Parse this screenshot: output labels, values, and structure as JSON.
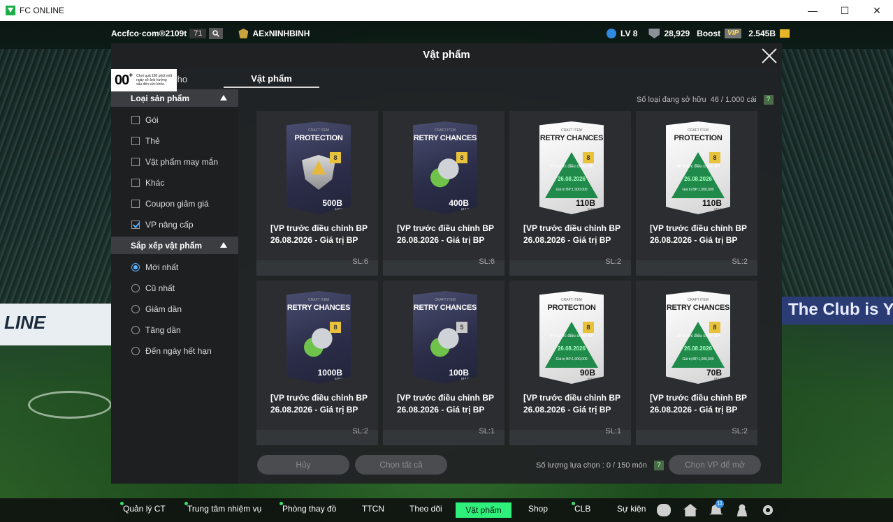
{
  "window": {
    "title": "FC ONLINE",
    "minimize": "—",
    "maximize": "☐",
    "close": "✕"
  },
  "topbar": {
    "account": "Accfco·com®2109t",
    "account_num": "71",
    "club_name": "AExNINHBINH",
    "level": "LV 8",
    "rank_points": "28,929",
    "boost": "Boost",
    "vip": "VIP",
    "bp": "2.545B"
  },
  "modal": {
    "title": "Vật phẩm",
    "rating": {
      "age": "00",
      "plus": "+",
      "notice": "Chơi quá 180 phút một ngày sẽ ảnh hưởng xấu đến sức khỏe."
    },
    "tabs": {
      "kho": "Kho",
      "vat_pham": "Vật phẩm"
    },
    "owned_label": "Số loại đang sở hữu",
    "owned_value": "46 / 1.000 cái",
    "help": "?"
  },
  "sidebar": {
    "type_header": "Loại sản phẩm",
    "types": [
      {
        "label": "Gói",
        "checked": false
      },
      {
        "label": "Thẻ",
        "checked": false
      },
      {
        "label": "Vật phẩm may mắn",
        "checked": false
      },
      {
        "label": "Khác",
        "checked": false
      },
      {
        "label": "Coupon giảm giá",
        "checked": false
      },
      {
        "label": "VP nâng cấp",
        "checked": true
      }
    ],
    "sort_header": "Sắp xếp vật phẩm",
    "sorts": [
      {
        "label": "Mới nhất",
        "selected": true
      },
      {
        "label": "Cũ nhất",
        "selected": false
      },
      {
        "label": "Giảm dần",
        "selected": false
      },
      {
        "label": "Tăng dần",
        "selected": false
      },
      {
        "label": "Đến ngày hết hạn",
        "selected": false
      }
    ]
  },
  "items": [
    {
      "style": "dark",
      "craft": "CRAFT ITEM",
      "title": "PROTECTION",
      "level": "8",
      "emblem": "shield",
      "price": "500B",
      "max": "MAX",
      "name": "[VP trước điều chỉnh BP 26.08.2026 - Giá trị BP",
      "qty": "SL:6"
    },
    {
      "style": "dark",
      "craft": "CRAFT ITEM",
      "title": "RETRY CHANCES",
      "level": "8",
      "emblem": "arrows",
      "price": "400B",
      "max": "MAX",
      "name": "[VP trước điều chỉnh BP 26.08.2026 - Giá trị BP",
      "qty": "SL:6"
    },
    {
      "style": "light",
      "craft": "CRAFT ITEM",
      "title": "RETRY CHANCES",
      "level": "8",
      "emblem": "tri",
      "tri_text": "VP trước điều chỉnh BP",
      "tri_date": "26.08.2026",
      "tri_bp": "Giá trị BP:1,000,000",
      "price": "110B",
      "max": "MAX",
      "name": "[VP trước điều chỉnh BP 26.08.2026 - Giá trị BP",
      "qty": "SL:2"
    },
    {
      "style": "light",
      "craft": "CRAFT ITEM",
      "title": "PROTECTION",
      "level": "8",
      "emblem": "tri",
      "tri_text": "VP trước điều chỉnh BP",
      "tri_date": "26.08.2026",
      "tri_bp": "Giá trị BP:1,000,000",
      "price": "110B",
      "max": "MAX",
      "name": "[VP trước điều chỉnh BP 26.08.2026 - Giá trị BP",
      "qty": "SL:2"
    },
    {
      "style": "dark",
      "craft": "CRAFT ITEM",
      "title": "RETRY CHANCES",
      "level": "8",
      "emblem": "arrows",
      "price": "1000B",
      "max": "MAX",
      "name": "[VP trước điều chỉnh BP 26.08.2026 - Giá trị BP",
      "qty": "SL:2"
    },
    {
      "style": "dark",
      "craft": "CRAFT ITEM",
      "title": "RETRY CHANCES",
      "level": "5",
      "emblem": "arrows",
      "price": "100B",
      "max": "MAX",
      "name": "[VP trước điều chỉnh BP 26.08.2026 - Giá trị BP",
      "qty": "SL:1"
    },
    {
      "style": "light",
      "craft": "CRAFT ITEM",
      "title": "PROTECTION",
      "level": "8",
      "emblem": "tri",
      "tri_text": "VP trước điều chỉnh BP",
      "tri_date": "26.08.2026",
      "tri_bp": "Giá trị BP:1,000,000",
      "price": "90B",
      "max": "MAX",
      "name": "[VP trước điều chỉnh BP 26.08.2026 - Giá trị BP",
      "qty": "SL:1"
    },
    {
      "style": "light",
      "craft": "CRAFT ITEM",
      "title": "RETRY CHANCES",
      "level": "8",
      "emblem": "tri",
      "tri_text": "VP trước điều chỉnh BP",
      "tri_date": "26.08.2026",
      "tri_bp": "Giá trị BP:1,000,000",
      "price": "70B",
      "max": "MAX",
      "name": "[VP trước điều chỉnh BP 26.08.2026 - Giá trị BP",
      "qty": "SL:2"
    }
  ],
  "actions": {
    "cancel": "Hủy",
    "select_all": "Chọn tất cả",
    "selection_label": "Số lượng lựa chọn : 0 / 150 món",
    "open": "Chọn VP để mở",
    "help": "?"
  },
  "background": {
    "board_left": "LINE",
    "board_right": "The Club is Y"
  },
  "nav": {
    "items": [
      "Quản lý CT",
      "Trung tâm nhiệm vụ",
      "Phòng thay đồ",
      "TTCN",
      "Theo dõi",
      "Vật phẩm",
      "Shop",
      "CLB",
      "Sự kiện"
    ],
    "notification_count": "11"
  }
}
